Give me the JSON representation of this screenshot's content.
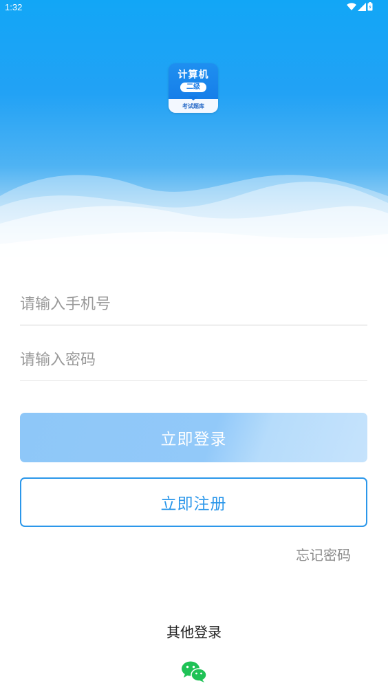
{
  "status_bar": {
    "time": "1:32"
  },
  "logo": {
    "title": "计算机",
    "badge": "二级",
    "subtitle": "考试题库"
  },
  "form": {
    "phone_placeholder": "请输入手机号",
    "password_placeholder": "请输入密码",
    "phone_value": "",
    "password_value": ""
  },
  "buttons": {
    "login_label": "立即登录",
    "register_label": "立即注册",
    "forgot_label": "忘记密码"
  },
  "other_login": {
    "label": "其他登录",
    "icons": [
      "wechat-icon"
    ]
  },
  "colors": {
    "primary": "#2b97ea",
    "header_blue": "#12a6f6",
    "login_button": "#8ec7f8",
    "wechat_green": "#1fc256"
  }
}
